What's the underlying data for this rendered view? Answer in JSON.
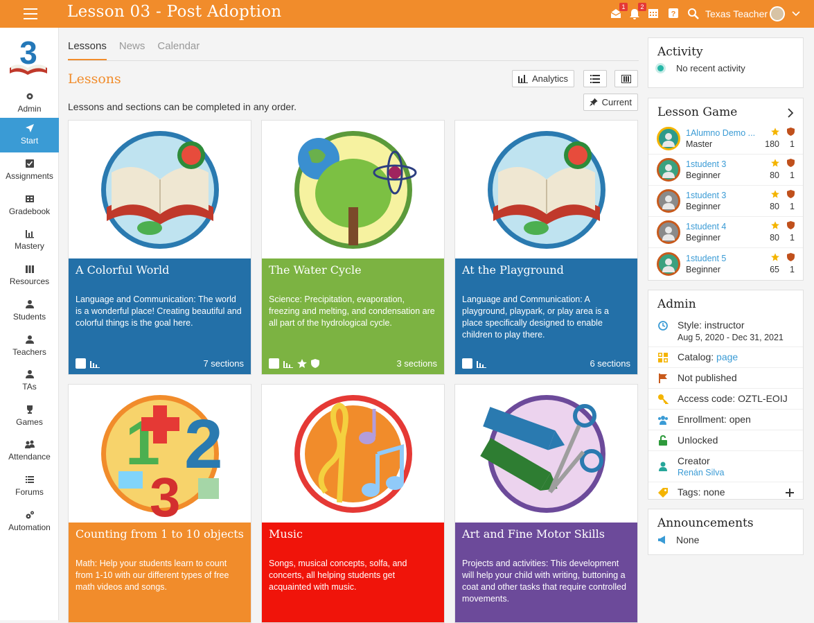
{
  "header": {
    "title": "Lesson 03 - Post Adoption",
    "notif_count": "1",
    "alert_count": "2",
    "user_name": "Texas Teacher"
  },
  "sidebar": {
    "items": [
      {
        "label": "Admin"
      },
      {
        "label": "Start"
      },
      {
        "label": "Assignments"
      },
      {
        "label": "Gradebook"
      },
      {
        "label": "Mastery"
      },
      {
        "label": "Resources"
      },
      {
        "label": "Students"
      },
      {
        "label": "Teachers"
      },
      {
        "label": "TAs"
      },
      {
        "label": "Games"
      },
      {
        "label": "Attendance"
      },
      {
        "label": "Forums"
      },
      {
        "label": "Automation"
      }
    ]
  },
  "tabs": [
    {
      "label": "Lessons"
    },
    {
      "label": "News"
    },
    {
      "label": "Calendar"
    }
  ],
  "main": {
    "section_title": "Lessons",
    "analytics_label": "Analytics",
    "current_label": "Current",
    "subtitle": "Lessons and sections can be completed in any order."
  },
  "cards": [
    {
      "title": "A Colorful World",
      "desc": "Language and Communication: The world is a wonderful place! Creating beautiful and colorful things is the goal here.",
      "sections": "7 sections",
      "color": "#2370a8"
    },
    {
      "title": "The Water Cycle",
      "desc": "Science: Precipitation, evaporation, freezing and melting, and condensation are all part of the hydrological cycle.",
      "sections": "3 sections",
      "color": "#7cb342"
    },
    {
      "title": "At the Playground",
      "desc": "Language and Communication: A playground, playpark, or play area is a place specifically designed to enable children to play there.",
      "sections": "6 sections",
      "color": "#2370a8"
    },
    {
      "title": "Counting from 1 to 10 objects",
      "desc": "Math: Help your students learn to count from 1-10 with our different types of free math videos and songs.",
      "color": "#f18c2b"
    },
    {
      "title": "Music",
      "desc": "Songs, musical concepts, solfa, and concerts, all helping students get acquainted with music.",
      "color": "#f0140a"
    },
    {
      "title": "Art and Fine Motor Skills",
      "desc": "Projects and activities: This development will help your child with writing, buttoning a coat and other tasks that require controlled movements.",
      "color": "#6c4a9a"
    }
  ],
  "activity": {
    "title": "Activity",
    "text": "No recent activity"
  },
  "lesson_game": {
    "title": "Lesson Game",
    "rows": [
      {
        "name": "1Alumno Demo ...",
        "level": "Master",
        "points": "180",
        "badges": "1"
      },
      {
        "name": "1student 3",
        "level": "Beginner",
        "points": "80",
        "badges": "1"
      },
      {
        "name": "1student 3",
        "level": "Beginner",
        "points": "80",
        "badges": "1"
      },
      {
        "name": "1student 4",
        "level": "Beginner",
        "points": "80",
        "badges": "1"
      },
      {
        "name": "1student 5",
        "level": "Beginner",
        "points": "65",
        "badges": "1"
      }
    ]
  },
  "admin": {
    "title": "Admin",
    "style": "Style: instructor",
    "dates": "Aug 5, 2020 - Dec 31, 2021",
    "catalog_label": "Catalog:",
    "catalog_link": "page",
    "published": "Not published",
    "access_code": "Access code: OZTL-EOIJ",
    "enrollment": "Enrollment: open",
    "unlocked": "Unlocked",
    "creator_label": "Creator",
    "creator_name": "Renán Silva",
    "tags": "Tags: none"
  },
  "announcements": {
    "title": "Announcements",
    "text": "None"
  }
}
